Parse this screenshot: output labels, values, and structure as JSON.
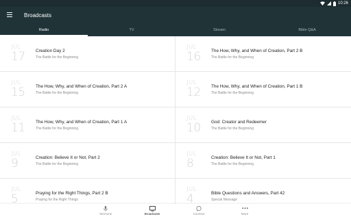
{
  "status_bar": {
    "time": "10:26",
    "icons": [
      "wifi-icon",
      "signal-icon",
      "battery-icon"
    ]
  },
  "app_bar": {
    "title": "Broadcasts",
    "menu_icon": "menu-icon"
  },
  "tabs": [
    {
      "label": "Radio",
      "active": true
    },
    {
      "label": "TV",
      "active": false
    },
    {
      "label": "Stream",
      "active": false
    },
    {
      "label": "Bible Q&A",
      "active": false
    }
  ],
  "broadcasts": [
    {
      "month": "JUL",
      "day": "17",
      "title": "Creation Day 2",
      "subtitle": "The Battle for the Beginning"
    },
    {
      "month": "JUL",
      "day": "16",
      "title": "The How, Why, and When of Creation, Part 2 B",
      "subtitle": "The Battle for the Beginning"
    },
    {
      "month": "JUL",
      "day": "15",
      "title": "The How, Why, and When of Creation, Part 2 A",
      "subtitle": "The Battle for the Beginning"
    },
    {
      "month": "JUL",
      "day": "12",
      "title": "The How, Why, and When of Creation, Part 1 B",
      "subtitle": "The Battle for the Beginning"
    },
    {
      "month": "JUL",
      "day": "11",
      "title": "The How, Why, and When of Creation, Part 1 A",
      "subtitle": "The Battle for the Beginning"
    },
    {
      "month": "JUL",
      "day": "10",
      "title": "God: Creator and Redeemer",
      "subtitle": "The Battle for the Beginning"
    },
    {
      "month": "JUL",
      "day": "9",
      "title": "Creation: Believe It or Not, Part 2",
      "subtitle": "The Battle for the Beginning"
    },
    {
      "month": "JUL",
      "day": "8",
      "title": "Creation: Believe It or Not, Part 1",
      "subtitle": "The Battle for the Beginning"
    },
    {
      "month": "JUL",
      "day": "5",
      "title": "Praying for the Right Things, Part 2 B",
      "subtitle": "Praying for the Right Things"
    },
    {
      "month": "JUL",
      "day": "4",
      "title": "Bible Questions and Answers, Part 42",
      "subtitle": "Special Message"
    }
  ],
  "bottom_nav": [
    {
      "label": "Sermons",
      "icon": "microphone-icon",
      "active": false
    },
    {
      "label": "Broadcasts",
      "icon": "tv-icon",
      "active": true
    },
    {
      "label": "Connect",
      "icon": "chat-bubble-icon",
      "active": false
    },
    {
      "label": "More",
      "icon": "more-dots-icon",
      "active": false
    }
  ]
}
